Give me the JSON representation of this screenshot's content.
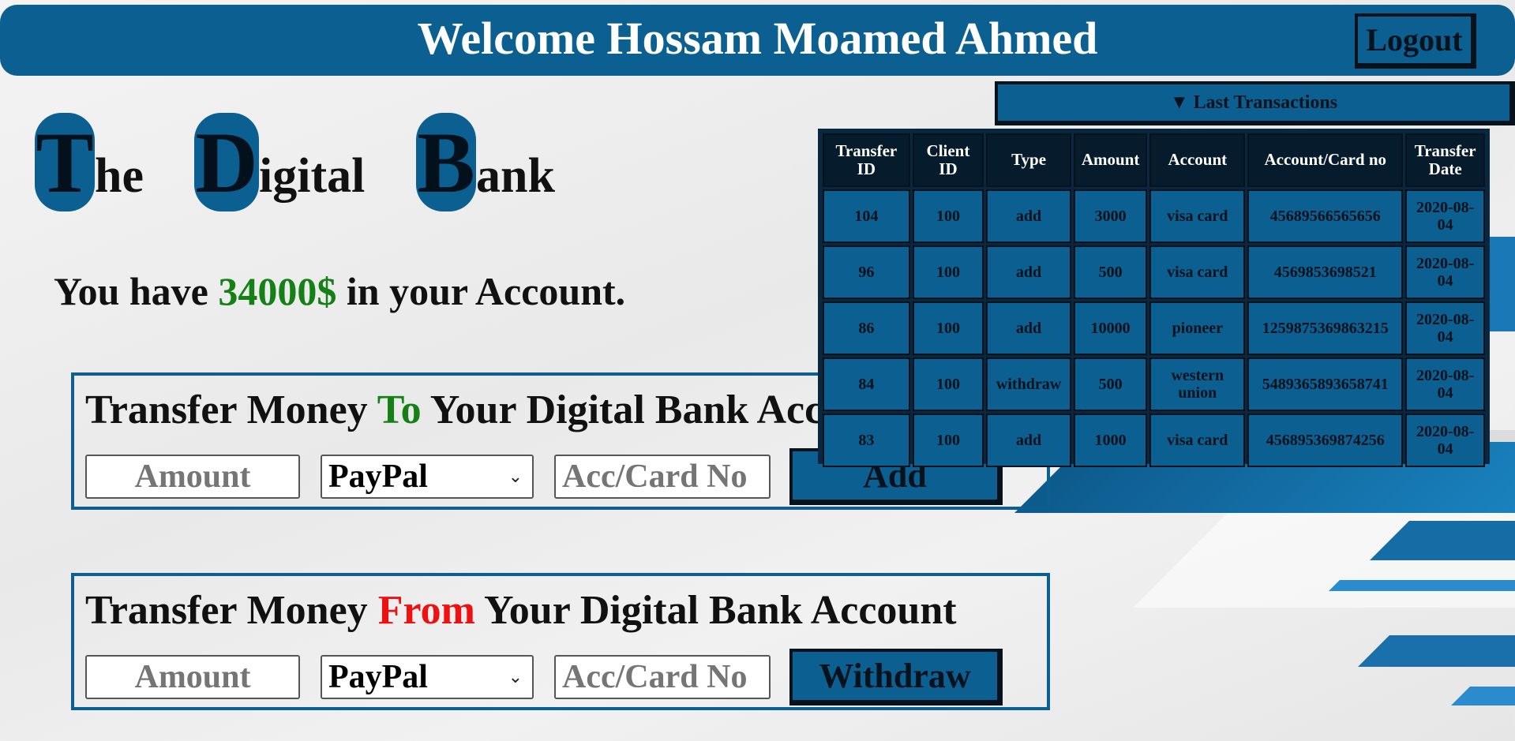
{
  "header": {
    "welcome": "Welcome Hossam Moamed Ahmed",
    "logout_label": "Logout"
  },
  "brand": {
    "words": [
      {
        "initial": "T",
        "rest": "he"
      },
      {
        "initial": "D",
        "rest": "igital"
      },
      {
        "initial": "B",
        "rest": "ank"
      }
    ]
  },
  "balance": {
    "prefix": "You have",
    "amount": "34000$",
    "suffix": "in your Account."
  },
  "deposit": {
    "title_pre": "Transfer Money",
    "title_key": "To",
    "title_post": "Your Digital Bank Account",
    "amount_placeholder": "Amount",
    "method_value": "PayPal",
    "account_placeholder": "Acc/Card No",
    "button_label": "Add"
  },
  "withdraw": {
    "title_pre": "Transfer Money",
    "title_key": "From",
    "title_post": "Your Digital Bank Account",
    "amount_placeholder": "Amount",
    "method_value": "PayPal",
    "account_placeholder": "Acc/Card No",
    "button_label": "Withdraw"
  },
  "transactions": {
    "toggle_label": "▼ Last Transactions",
    "headers": [
      "Transfer ID",
      "Client ID",
      "Type",
      "Amount",
      "Account",
      "Account/Card no",
      "Transfer Date"
    ],
    "rows": [
      [
        "104",
        "100",
        "add",
        "3000",
        "visa card",
        "45689566565656",
        "2020-08-04"
      ],
      [
        "96",
        "100",
        "add",
        "500",
        "visa card",
        "4569853698521",
        "2020-08-04"
      ],
      [
        "86",
        "100",
        "add",
        "10000",
        "pioneer",
        "1259875369863215",
        "2020-08-04"
      ],
      [
        "84",
        "100",
        "withdraw",
        "500",
        "western union",
        "5489365893658741",
        "2020-08-04"
      ],
      [
        "83",
        "100",
        "add",
        "1000",
        "visa card",
        "456895369874256",
        "2020-08-04"
      ]
    ]
  },
  "colors": {
    "primary": "#0b5f91",
    "dark": "#06121c",
    "positive": "#158015",
    "negative": "#ee1111"
  }
}
